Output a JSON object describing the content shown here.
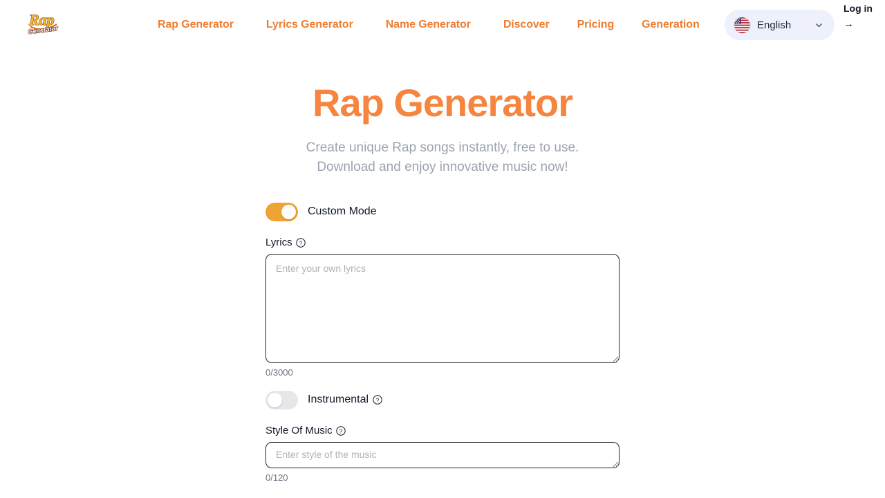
{
  "header": {
    "logo_alt": "Rap Generator",
    "nav": [
      {
        "label": "Rap Generator"
      },
      {
        "label": "Lyrics Generator"
      },
      {
        "label": "Name Generator"
      },
      {
        "label": "Discover"
      },
      {
        "label": "Pricing"
      },
      {
        "label": "Generation"
      }
    ],
    "language": {
      "flag": "us-flag-icon",
      "label": "English",
      "chevron": "chevron-down-icon"
    },
    "login": {
      "label": "Log in",
      "arrow": "→"
    },
    "accent_color": "#ED7D31",
    "lang_bg_color": "#EEF1FB"
  },
  "hero": {
    "title": "Rap Generator",
    "subtitle_line1": "Create unique Rap songs instantly, free to use.",
    "subtitle_line2": "Download and enjoy innovative music now!",
    "title_color": "#F5853F",
    "subtitle_color": "#9CA3AF"
  },
  "form": {
    "custom_mode": {
      "label": "Custom Mode",
      "state": "on",
      "on_color": "#EFA335"
    },
    "lyrics": {
      "label": "Lyrics",
      "help_icon": "question-circle-icon",
      "placeholder": "Enter your own lyrics",
      "value": "",
      "counter": "0/3000"
    },
    "instrumental": {
      "label": "Instrumental",
      "help_icon": "question-circle-icon",
      "state": "off",
      "off_color": "#E5E7EB"
    },
    "style_of_music": {
      "label": "Style Of Music",
      "help_icon": "question-circle-icon",
      "placeholder": "Enter style of the music",
      "value": "",
      "counter": "0/120"
    }
  }
}
